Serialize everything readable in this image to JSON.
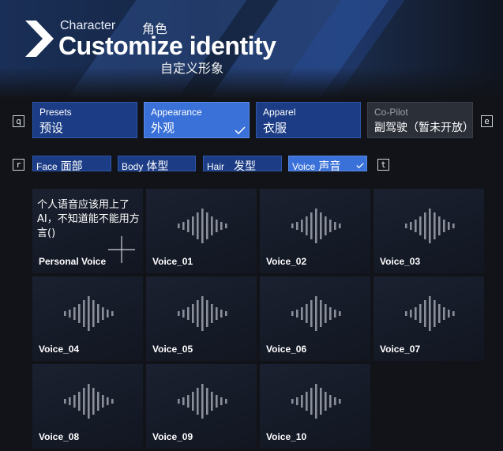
{
  "header": {
    "category": "Character",
    "category_cn": "角色",
    "title": "Customize identity",
    "subtitle_cn": "自定义形象"
  },
  "key_hints": {
    "tabs_prev": "q",
    "tabs_next": "e",
    "subtabs_prev": "r",
    "subtabs_next": "t"
  },
  "tabs": [
    {
      "en": "Presets",
      "cn": "预设",
      "state": "normal"
    },
    {
      "en": "Appearance",
      "cn": "外观",
      "state": "active"
    },
    {
      "en": "Apparel",
      "cn": "衣服",
      "state": "normal"
    },
    {
      "en": "Co-Pilot",
      "cn": "副驾驶（暂未开放）",
      "state": "disabled"
    }
  ],
  "subtabs": [
    {
      "en": "Face",
      "cn": "面部",
      "state": "normal"
    },
    {
      "en": "Body",
      "cn": "体型",
      "state": "normal"
    },
    {
      "en": "Hair",
      "cn": "发型",
      "state": "normal"
    },
    {
      "en": "Voice",
      "cn": "声音",
      "state": "active"
    }
  ],
  "voices": [
    {
      "label": "Personal Voice",
      "note": "个人语音应该用上了AI，不知道能不能用方言()",
      "icon": "plus-icon"
    },
    {
      "label": "Voice_01",
      "icon": "waveform-icon"
    },
    {
      "label": "Voice_02",
      "icon": "waveform-icon"
    },
    {
      "label": "Voice_03",
      "icon": "waveform-icon"
    },
    {
      "label": "Voice_04",
      "icon": "waveform-icon"
    },
    {
      "label": "Voice_05",
      "icon": "waveform-icon"
    },
    {
      "label": "Voice_06",
      "icon": "waveform-icon"
    },
    {
      "label": "Voice_07",
      "icon": "waveform-icon"
    },
    {
      "label": "Voice_08",
      "icon": "waveform-icon"
    },
    {
      "label": "Voice_09",
      "icon": "waveform-icon"
    },
    {
      "label": "Voice_10",
      "icon": "waveform-icon"
    }
  ],
  "colors": {
    "tab_normal": "#1c3d86",
    "tab_active": "#3a71d8",
    "tab_disabled": "#2b2f38",
    "tile_bg": "#161b28",
    "waveform": "#8a8f9a"
  }
}
